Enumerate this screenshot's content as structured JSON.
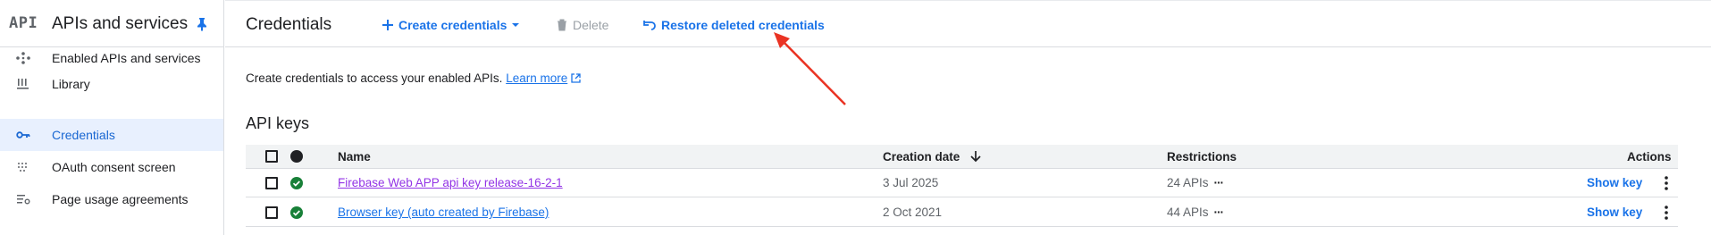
{
  "sidebar": {
    "logo_text": "API",
    "title": "APIs and services",
    "items": [
      {
        "label": "Enabled APIs and services",
        "icon": "hub-icon",
        "active": false
      },
      {
        "label": "Library",
        "icon": "library-icon",
        "active": false
      },
      {
        "label": "Credentials",
        "icon": "key-icon",
        "active": true
      },
      {
        "label": "OAuth consent screen",
        "icon": "oauth-icon",
        "active": false
      },
      {
        "label": "Page usage agreements",
        "icon": "settings-list-icon",
        "active": false
      }
    ]
  },
  "header": {
    "title": "Credentials",
    "create_label": "Create credentials",
    "delete_label": "Delete",
    "restore_label": "Restore deleted credentials"
  },
  "main": {
    "intro_text": "Create credentials to access your enabled APIs.",
    "learn_more": "Learn more",
    "section_title": "API keys",
    "columns": {
      "name": "Name",
      "creation_date": "Creation date",
      "restrictions": "Restrictions",
      "actions": "Actions"
    },
    "rows": [
      {
        "name": "Firebase Web APP api key release-16-2-1",
        "date": "3 Jul 2025",
        "restrictions": "24 APIs",
        "action": "Show key"
      },
      {
        "name": "Browser key (auto created by Firebase)",
        "date": "2 Oct 2021",
        "restrictions": "44 APIs",
        "action": "Show key"
      }
    ]
  },
  "colors": {
    "accent": "#1a73e8",
    "active_bg": "#e8f0fe",
    "visited_link": "#9334e6",
    "status_green": "#188038",
    "annotation_red": "#ea3323"
  }
}
